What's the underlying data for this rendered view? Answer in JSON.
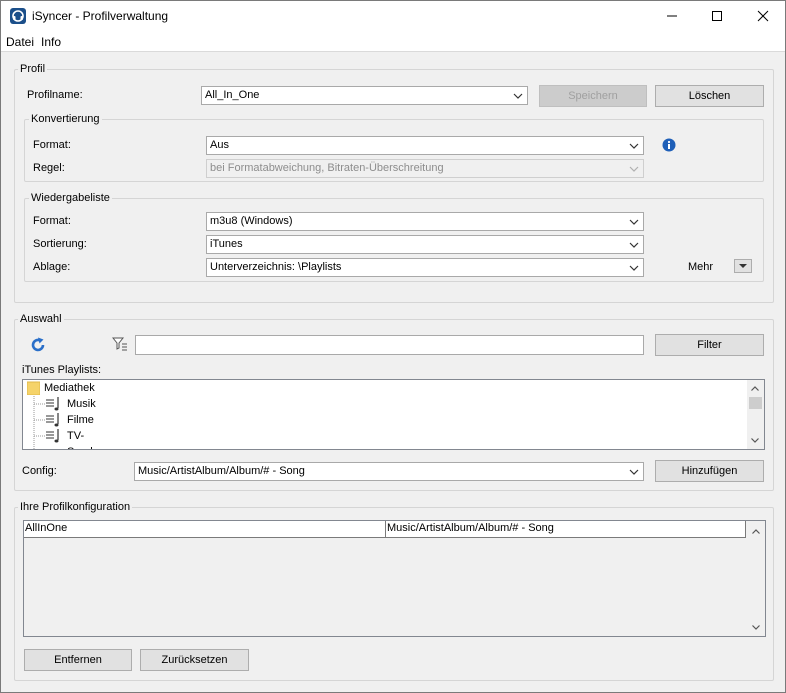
{
  "window": {
    "title": "iSyncer - Profilverwaltung"
  },
  "menu": {
    "items": [
      "Datei",
      "Info"
    ]
  },
  "profil": {
    "group_label": "Profil",
    "name_label": "Profilname:",
    "name_value": "All_In_One",
    "save_label": "Speichern",
    "delete_label": "Löschen",
    "konvertierung": {
      "group_label": "Konvertierung",
      "format_label": "Format:",
      "format_value": "Aus",
      "regel_label": "Regel:",
      "regel_value": "bei Formatabweichung, Bitraten-Überschreitung"
    },
    "wiedergabeliste": {
      "group_label": "Wiedergabeliste",
      "format_label": "Format:",
      "format_value": "m3u8 (Windows)",
      "sortierung_label": "Sortierung:",
      "sortierung_value": "iTunes",
      "ablage_label": "Ablage:",
      "ablage_value": "Unterverzeichnis: \\Playlists",
      "mehr_label": "Mehr"
    }
  },
  "auswahl": {
    "group_label": "Auswahl",
    "filter_value": "",
    "filter_button": "Filter",
    "playlists_label": "iTunes Playlists:",
    "tree": [
      {
        "label": "Mediathek",
        "icon": "folder-icon"
      },
      {
        "label": "Musik",
        "icon": "playlist-icon"
      },
      {
        "label": "Filme",
        "icon": "playlist-icon"
      },
      {
        "label": "TV-Sendungen",
        "icon": "playlist-icon"
      }
    ],
    "config_label": "Config:",
    "config_value": "Music/ArtistAlbum/Album/# - Song",
    "add_button": "Hinzufügen"
  },
  "profilkonfiguration": {
    "group_label": "Ihre Profilkonfiguration",
    "rows": [
      {
        "name": "AllInOne",
        "config": "Music/ArtistAlbum/Album/# - Song"
      }
    ],
    "remove_button": "Entfernen",
    "reset_button": "Zurücksetzen"
  },
  "colors": {
    "info_icon": "#1e5fb8",
    "refresh_icon": "#2a6fc9",
    "folder_icon": "#f5d36a"
  }
}
